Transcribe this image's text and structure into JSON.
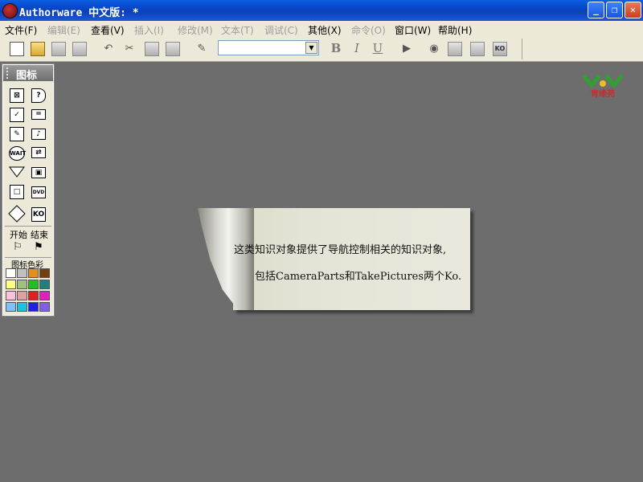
{
  "window": {
    "title": "Authorware 中文版: *"
  },
  "menu": [
    {
      "label": "文件(F)",
      "disabled": false
    },
    {
      "label": "编辑(E)",
      "disabled": true
    },
    {
      "label": "查看(V)",
      "disabled": false
    },
    {
      "label": "插入(I)",
      "disabled": true
    },
    {
      "label": "修改(M)",
      "disabled": true
    },
    {
      "label": "文本(T)",
      "disabled": true
    },
    {
      "label": "调试(C)",
      "disabled": true
    },
    {
      "label": "其他(X)",
      "disabled": false
    },
    {
      "label": "命令(O)",
      "disabled": true
    },
    {
      "label": "窗口(W)",
      "disabled": false
    },
    {
      "label": "帮助(H)",
      "disabled": false
    }
  ],
  "toolbar": {
    "font_combo_value": "",
    "bold_label": "B",
    "italic_label": "I",
    "underline_label": "U",
    "ko_label": "KO"
  },
  "logo": {
    "text": "育缘苑"
  },
  "icon_palette": {
    "title": "图标",
    "icons": [
      "display-icon",
      "decision-icon",
      "calculation-icon",
      "interaction-icon",
      "erase-icon",
      "sound-icon",
      "wait-icon",
      "navigate-icon",
      "motion-icon",
      "movie-icon",
      "framework-icon",
      "dvd-icon",
      "map-icon",
      "knowledge-object-icon"
    ],
    "wait_label": "WAIT",
    "ko_label": "KO",
    "start_label": "开始",
    "end_label": "结束",
    "color_label": "图标色彩",
    "colors": [
      "#ffffff",
      "#c0c0c0",
      "#e09020",
      "#704010",
      "#ffff80",
      "#a0c080",
      "#20c020",
      "#208080",
      "#ffc0e0",
      "#e0a0a0",
      "#e02020",
      "#e020c0",
      "#80c0ff",
      "#20c0e0",
      "#2020e0",
      "#8060e0"
    ]
  },
  "card": {
    "line1": "这类知识对象提供了导航控制相关的知识对象,",
    "line2": "包括CameraParts和TakePictures两个Ko."
  }
}
